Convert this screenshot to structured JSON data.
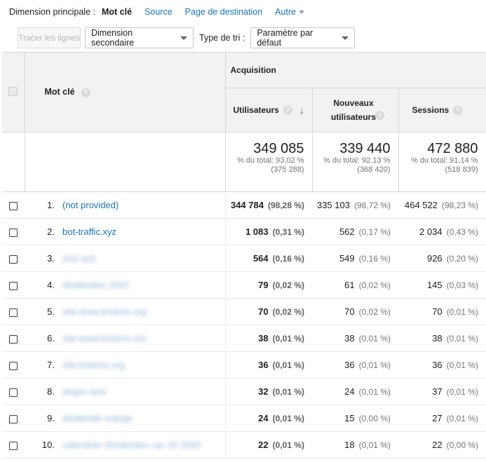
{
  "dimension_bar": {
    "label": "Dimension principale :",
    "active": "Mot clé",
    "links": [
      "Source",
      "Page de destination"
    ],
    "more": "Autre"
  },
  "toolbar": {
    "plot_rows": "Tracer les lignes",
    "secondary_dimension": "Dimension secondaire",
    "sort_type_label": "Type de tri :",
    "sort_type_value": "Paramètre par défaut"
  },
  "table": {
    "keyword_header": "Mot clé",
    "group_header": "Acquisition",
    "metric_headers": [
      "Utilisateurs",
      "Nouveaux utilisateurs",
      "Sessions"
    ],
    "totals": [
      {
        "value": "349 085",
        "pct": "% du total: 93,02 %",
        "of": "(375 288)"
      },
      {
        "value": "339 440",
        "pct": "% du total: 92,13 %",
        "of": "(368 420)"
      },
      {
        "value": "472 880",
        "pct": "% du total: 91,14 %",
        "of": "(518 839)"
      }
    ],
    "rows": [
      {
        "num": "1.",
        "keyword": "(not provided)",
        "users": "344 784",
        "users_pct": "(98,28 %)",
        "new": "335 103",
        "new_pct": "(98,72 %)",
        "sessions": "464 522",
        "sessions_pct": "(98,23 %)"
      },
      {
        "num": "2.",
        "keyword": "bot-traffic.xyz",
        "users": "1 083",
        "users_pct": "(0,31 %)",
        "new": "562",
        "new_pct": "(0,17 %)",
        "sessions": "2 034",
        "sessions_pct": "(0,43 %)"
      },
      {
        "num": "3.",
        "keyword": "(not set)",
        "users": "564",
        "users_pct": "(0,16 %)",
        "new": "549",
        "new_pct": "(0,16 %)",
        "sessions": "926",
        "sessions_pct": "(0,20 %)"
      },
      {
        "num": "4.",
        "keyword": "dividendes 2020",
        "users": "79",
        "users_pct": "(0,02 %)",
        "new": "61",
        "new_pct": "(0,02 %)",
        "sessions": "145",
        "sessions_pct": "(0,03 %)"
      },
      {
        "num": "5.",
        "keyword": "site:www.bnairns.org",
        "users": "70",
        "users_pct": "(0,02 %)",
        "new": "70",
        "new_pct": "(0,02 %)",
        "sessions": "70",
        "sessions_pct": "(0,01 %)"
      },
      {
        "num": "6.",
        "keyword": "site:www.bnairns.net",
        "users": "38",
        "users_pct": "(0,01 %)",
        "new": "38",
        "new_pct": "(0,01 %)",
        "sessions": "38",
        "sessions_pct": "(0,01 %)"
      },
      {
        "num": "7.",
        "keyword": "site:bnairns.org",
        "users": "36",
        "users_pct": "(0,01 %)",
        "new": "36",
        "new_pct": "(0,01 %)",
        "sessions": "36",
        "sessions_pct": "(0,01 %)"
      },
      {
        "num": "8.",
        "keyword": "degiro avis",
        "users": "32",
        "users_pct": "(0,01 %)",
        "new": "24",
        "new_pct": "(0,01 %)",
        "sessions": "37",
        "sessions_pct": "(0,01 %)"
      },
      {
        "num": "9.",
        "keyword": "dividende orange",
        "users": "24",
        "users_pct": "(0,01 %)",
        "new": "15",
        "new_pct": "(0,00 %)",
        "sessions": "27",
        "sessions_pct": "(0,01 %)"
      },
      {
        "num": "10.",
        "keyword": "calendrier dividendes cac 40 2020",
        "users": "22",
        "users_pct": "(0,01 %)",
        "new": "18",
        "new_pct": "(0,01 %)",
        "sessions": "22",
        "sessions_pct": "(0,00 %)"
      }
    ]
  }
}
